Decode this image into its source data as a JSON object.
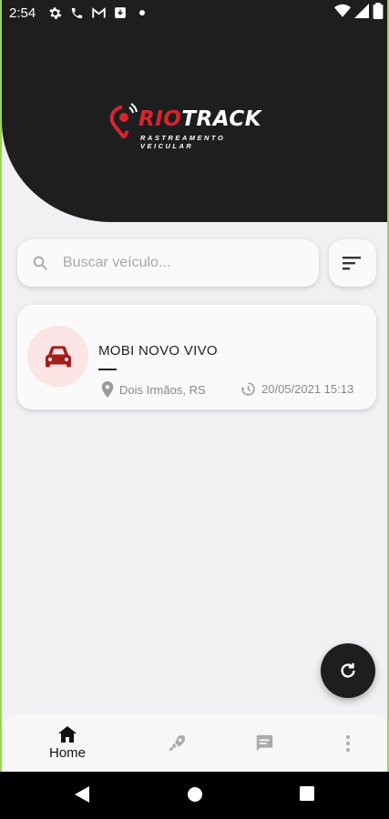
{
  "status_bar": {
    "time": "2:54",
    "icons": [
      "gear-icon",
      "phone-icon",
      "gmail-icon",
      "download-box-icon",
      "dot-icon"
    ],
    "right_icons": [
      "wifi-icon",
      "signal-icon",
      "battery-icon"
    ]
  },
  "logo": {
    "brand_prefix": "RIO",
    "brand_suffix": "TRACK",
    "subtitle": "RASTREAMENTO VEICULAR"
  },
  "search": {
    "placeholder": "Buscar veículo..."
  },
  "vehicles": [
    {
      "name": "MOBI NOVO VIVO",
      "location": "Dois Irmãos, RS",
      "datetime": "20/05/2021 15:13",
      "icon": "car-icon"
    }
  ],
  "bottom_nav": {
    "items": [
      {
        "label": "Home",
        "icon": "home-icon",
        "active": true
      },
      {
        "label": "",
        "icon": "rocket-icon",
        "active": false
      },
      {
        "label": "",
        "icon": "message-icon",
        "active": false
      },
      {
        "label": "",
        "icon": "more-vert-icon",
        "active": false
      }
    ]
  },
  "colors": {
    "header": "#1e1e1f",
    "accent_red": "#d8242f",
    "avatar_bg": "#fbe4e4",
    "car_icon": "#a51d1d",
    "background": "#f1f1f3"
  }
}
